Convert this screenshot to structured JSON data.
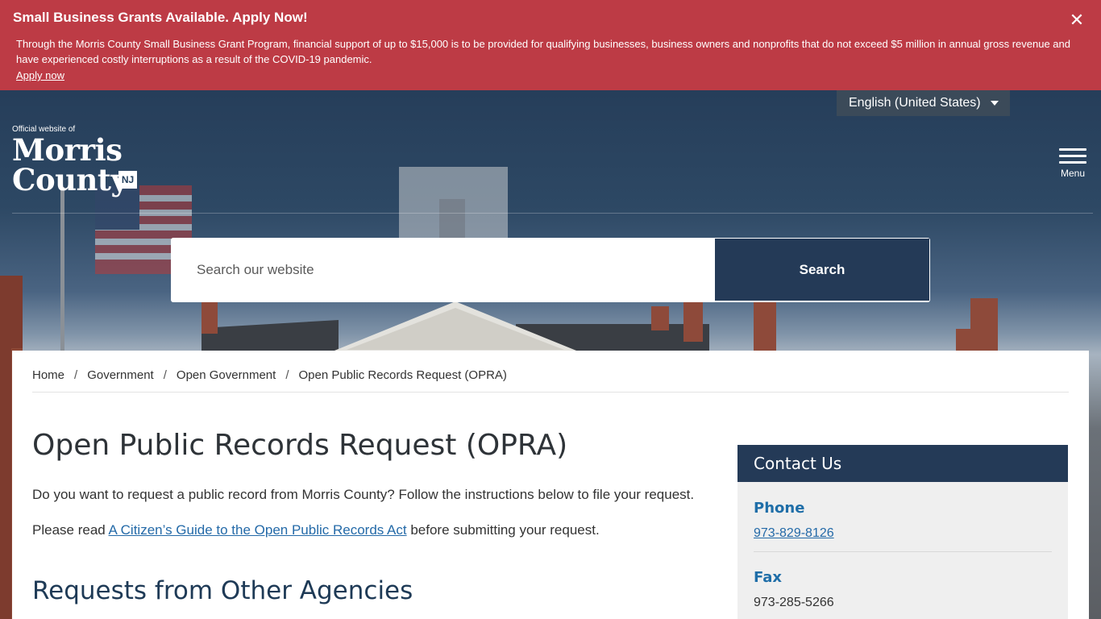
{
  "alert": {
    "title": "Small Business Grants Available. Apply Now!",
    "body": "Through the Morris County Small Business Grant Program, financial support of up to $15,000 is to be provided for qualifying businesses, business owners and nonprofits that do not exceed $5 million in annual gross revenue and have experienced costly interruptions as a result of the COVID-19 pandemic.",
    "link": "Apply now",
    "close_symbol": "✕"
  },
  "header": {
    "language": "English (United States)",
    "logo_small": "Official website of",
    "logo_line1": "Morris",
    "logo_line2": "County",
    "logo_badge": "NJ",
    "menu_label": "Menu"
  },
  "search": {
    "placeholder": "Search our website",
    "button_label": "Search"
  },
  "breadcrumb": {
    "items": [
      "Home",
      "Government",
      "Open Government",
      "Open Public Records Request (OPRA)"
    ],
    "separator": "/"
  },
  "main": {
    "title": "Open Public Records Request (OPRA)",
    "para1": "Do you want to request a public record from Morris County? Follow the instructions below to file your request.",
    "para2_before": "Please read ",
    "para2_link": "A Citizen’s Guide to the Open Public Records Act",
    "para2_after": " before submitting your request.",
    "section_heading": "Requests from Other Agencies"
  },
  "contact": {
    "heading": "Contact Us",
    "phone_label": "Phone",
    "phone_value": "973-829-8126",
    "fax_label": "Fax",
    "fax_value": "973-285-5266"
  },
  "colors": {
    "alert_bg": "#bd3b45",
    "navy": "#243a57",
    "link_blue": "#246aa8"
  }
}
